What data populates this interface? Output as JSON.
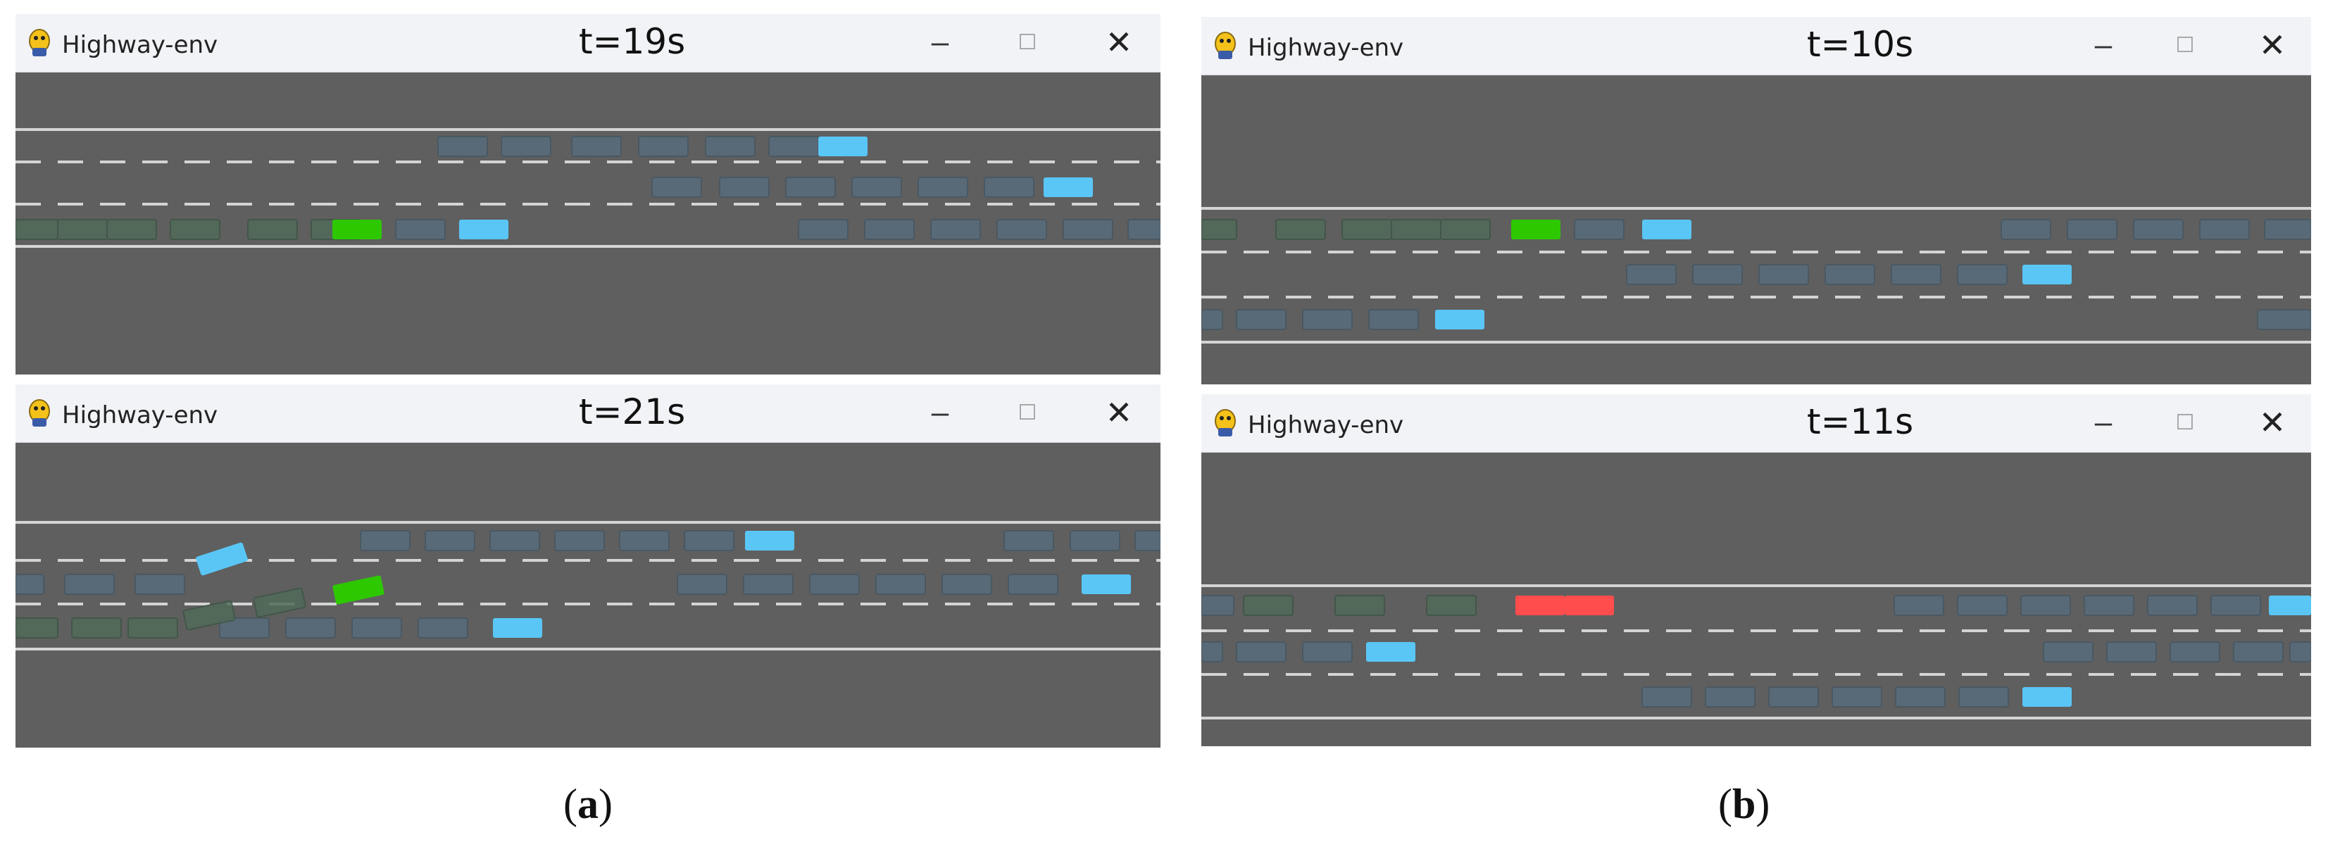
{
  "windows": [
    {
      "app_title": "Highway-env",
      "time": "t=19s"
    },
    {
      "app_title": "Highway-env",
      "time": "t=21s"
    },
    {
      "app_title": "Highway-env",
      "time": "t=10s"
    },
    {
      "app_title": "Highway-env",
      "time": "t=11s"
    }
  ],
  "captions": [
    {
      "open": "(",
      "letter": "a",
      "close": ")"
    },
    {
      "open": "(",
      "letter": "b",
      "close": ")"
    }
  ],
  "icons": {
    "app": "pygame-snake-icon",
    "minimize": "minimize-icon",
    "maximize": "maximize-icon",
    "close": "close-icon"
  },
  "window_buttons": {
    "minimize": "–",
    "maximize": "☐",
    "close": "✕"
  },
  "colors": {
    "background": "#5f5f5f",
    "lane_line": "#d4d4d4",
    "vehicle": "#586a78",
    "ego": "#2ec800",
    "ego_crashed": "#ff4c4c",
    "target": "#5ac6f6",
    "trail": "#506a58"
  }
}
